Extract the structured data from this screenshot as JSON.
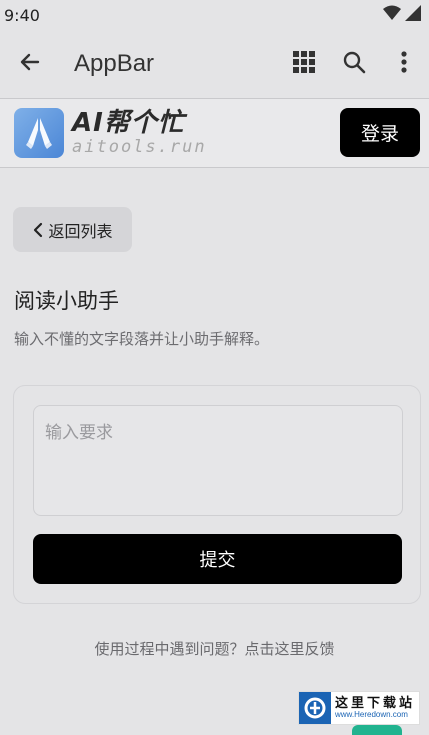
{
  "status_bar": {
    "time": "9:40"
  },
  "appbar": {
    "title": "AppBar"
  },
  "site_header": {
    "logo_main": "AI帮个忙",
    "logo_sub": "aitools.run",
    "login_label": "登录"
  },
  "nav": {
    "back_to_list_label": "返回列表"
  },
  "page": {
    "title": "阅读小助手",
    "description": "输入不懂的文字段落并让小助手解释。"
  },
  "form": {
    "input_placeholder": "输入要求",
    "input_value": "",
    "submit_label": "提交"
  },
  "footer": {
    "feedback_text": "使用过程中遇到问题？点击这里反馈"
  },
  "watermark": {
    "main": "这里下载站",
    "sub": "www.Heredown.com"
  },
  "colors": {
    "background": "#e4e4e6",
    "primary_button": "#000000",
    "logo_blue": "#4b86d6",
    "fab_green": "#21b38f"
  },
  "icons": [
    "arrow-back-icon",
    "apps-grid-icon",
    "search-icon",
    "more-vert-icon",
    "wifi-icon",
    "signal-icon",
    "chevron-left-icon"
  ]
}
